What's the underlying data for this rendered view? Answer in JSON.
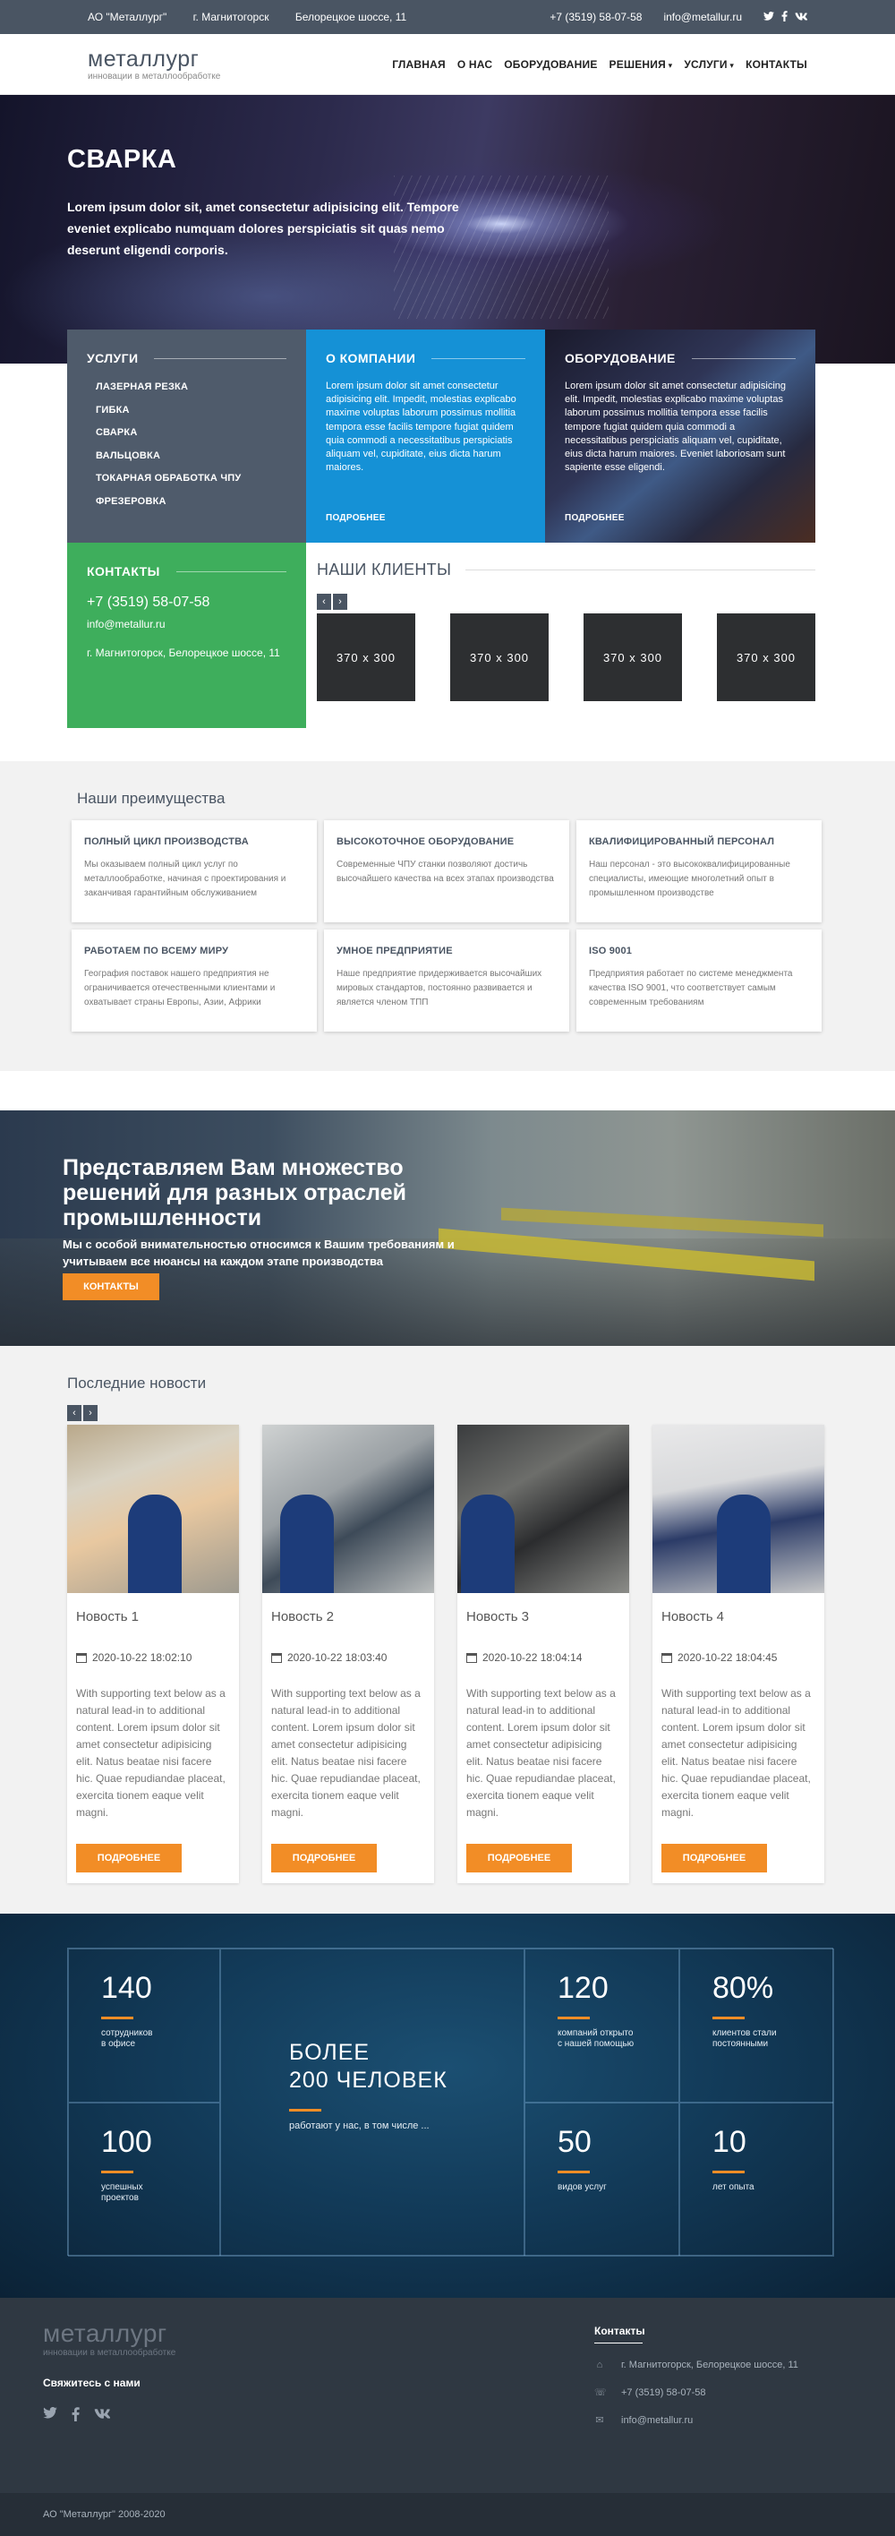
{
  "topbar": {
    "company": "АО \"Металлург\"",
    "city": "г. Магнитогорск",
    "address": "Белорецкое шоссе, 11",
    "phone": "+7 (3519) 58-07-58",
    "email": "info@metallur.ru",
    "social": [
      "twitter-icon",
      "facebook-icon",
      "vk-icon"
    ]
  },
  "header": {
    "logo_name": "металлург",
    "logo_tagline": "инновации в металлообработке",
    "nav": [
      "ГЛАВНАЯ",
      "О НАС",
      "ОБОРУДОВАНИЕ",
      "РЕШЕНИЯ",
      "УСЛУГИ",
      "КОНТАКТЫ"
    ]
  },
  "hero": {
    "title": "СВАРКА",
    "text": "Lorem ipsum dolor sit, amet consectetur adipisicing elit. Tempore eveniet explicabo numquam dolores perspiciatis sit quas nemo deserunt eligendi corporis."
  },
  "tiles": {
    "services": {
      "title": "УСЛУГИ",
      "items": [
        "ЛАЗЕРНАЯ РЕЗКА",
        "ГИБКА",
        "СВАРКА",
        "ВАЛЬЦОВКА",
        "ТОКАРНАЯ ОБРАБОТКА ЧПУ",
        "ФРЕЗЕРОВКА"
      ]
    },
    "company": {
      "title": "О КОМПАНИИ",
      "text": "Lorem ipsum dolor sit amet consectetur adipisicing elit. Impedit, molestias explicabo maxime voluptas laborum possimus mollitia tempora esse facilis tempore fugiat quidem quia commodi a necessitatibus perspiciatis aliquam vel, cupiditate, eius dicta harum maiores.",
      "more": "ПОДРОБНЕЕ"
    },
    "equipment": {
      "title": "ОБОРУДОВАНИЕ",
      "text": "Lorem ipsum dolor sit amet consectetur adipisicing elit. Impedit, molestias explicabo maxime voluptas laborum possimus mollitia tempora esse facilis tempore fugiat quidem quia commodi a necessitatibus perspiciatis aliquam vel, cupiditate, eius dicta harum maiores. Eveniet laboriosam sunt sapiente esse eligendi.",
      "more": "ПОДРОБНЕЕ"
    },
    "contacts": {
      "title": "КОНТАКТЫ",
      "phone": "+7 (3519) 58-07-58",
      "email": "info@metallur.ru",
      "address": "г. Магнитогорск, Белорецкое шоссе, 11"
    }
  },
  "clients": {
    "title": "НАШИ КЛИЕНТЫ",
    "prev": "‹",
    "next": "›",
    "logos": [
      "370 x 300",
      "370 x 300",
      "370 x 300",
      "370 x 300"
    ]
  },
  "advantages": {
    "title": "Наши преимущества",
    "items": [
      {
        "title": "ПОЛНЫЙ ЦИКЛ ПРОИЗВОДСТВА",
        "text": "Мы оказываем полный цикл услуг по металлообработке, начиная с проектирования и заканчивая гарантийным обслуживанием"
      },
      {
        "title": "ВЫСОКОТОЧНОЕ ОБОРУДОВАНИЕ",
        "text": "Современные ЧПУ станки позволяют достичь высочайшего качества на всех этапах производства"
      },
      {
        "title": "КВАЛИФИЦИРОВАННЫЙ ПЕРСОНАЛ",
        "text": "Наш персонал - это высококвалифицированные специалисты, имеющие многолетний опыт в промышленном производстве"
      },
      {
        "title": "РАБОТАЕМ ПО ВСЕМУ МИРУ",
        "text": "География поставок нашего предприятия не ограничивается отечественными клиентами и охватывает страны Европы, Азии, Африки"
      },
      {
        "title": "УМНОЕ ПРЕДПРИЯТИЕ",
        "text": "Наше предприятие придерживается высочайших мировых стандартов, постоянно развивается и является членом ТПП"
      },
      {
        "title": "ISO 9001",
        "text": "Предприятия работает по системе менеджмента качества ISO 9001, что соответствует самым современным требованиям"
      }
    ]
  },
  "banner": {
    "title": "Представляем Вам множество решений для разных отраслей промышленности",
    "subtitle": "Мы с особой внимательностью относимся к Вашим требованиям и учитываем все нюансы на каждом этапе производства",
    "button": "КОНТАКТЫ"
  },
  "news": {
    "title": "Последние новости",
    "prev": "‹",
    "next": "›",
    "items": [
      {
        "title": "Новость 1",
        "date": "2020-10-22 18:02:10",
        "text": "With supporting text below as a natural lead-in to additional content. Lorem ipsum dolor sit amet consectetur adipisicing elit. Natus beatae nisi facere hic. Quae repudiandae placeat, exercita tionem eaque velit magni.",
        "button": "ПОДРОБНЕЕ"
      },
      {
        "title": "Новость 2",
        "date": "2020-10-22 18:03:40",
        "text": "With supporting text below as a natural lead-in to additional content. Lorem ipsum dolor sit amet consectetur adipisicing elit. Natus beatae nisi facere hic. Quae repudiandae placeat, exercita tionem eaque velit magni.",
        "button": "ПОДРОБНЕЕ"
      },
      {
        "title": "Новость 3",
        "date": "2020-10-22 18:04:14",
        "text": "With supporting text below as a natural lead-in to additional content. Lorem ipsum dolor sit amet consectetur adipisicing elit. Natus beatae nisi facere hic. Quae repudiandae placeat, exercita tionem eaque velit magni.",
        "button": "ПОДРОБНЕЕ"
      },
      {
        "title": "Новость 4",
        "date": "2020-10-22 18:04:45",
        "text": "With supporting text below as a natural lead-in to additional content. Lorem ipsum dolor sit amet consectetur adipisicing elit. Natus beatae nisi facere hic. Quae repudiandae placeat, exercita tionem eaque velit magni.",
        "button": "ПОДРОБНЕЕ"
      }
    ]
  },
  "stats": {
    "center_line1": "БОЛЕЕ",
    "center_line2": "200 ЧЕЛОВЕК",
    "center_label": "работают у нас, в том числе ...",
    "items": [
      {
        "num": "140",
        "label1": "сотрудников",
        "label2": "в офисе"
      },
      {
        "num": "100",
        "label1": "успешных",
        "label2": "проектов"
      },
      {
        "num": "120",
        "label1": "компаний открыто",
        "label2": "с нашей помощью"
      },
      {
        "num": "80%",
        "label1": "клиентов стали",
        "label2": "постоянными"
      },
      {
        "num": "50",
        "label1": "видов услуг",
        "label2": ""
      },
      {
        "num": "10",
        "label1": "лет опыта",
        "label2": ""
      }
    ]
  },
  "footer": {
    "logo_name": "металлург",
    "logo_tagline": "инновации в металлообработке",
    "contact_us": "Свяжитесь с нами",
    "contacts_title": "Контакты",
    "address": "г. Магнитогорск, Белорецкое шоссе, 11",
    "phone": "+7 (3519) 58-07-58",
    "email": "info@metallur.ru",
    "copyright": "АО \"Металлург\" 2008-2020"
  },
  "colors": {
    "accent": "#f28d26",
    "topbar": "#4a5563",
    "services_tile": "#4f5b6b",
    "company_tile": "#1591d6",
    "contacts_tile": "#3eae5c"
  }
}
